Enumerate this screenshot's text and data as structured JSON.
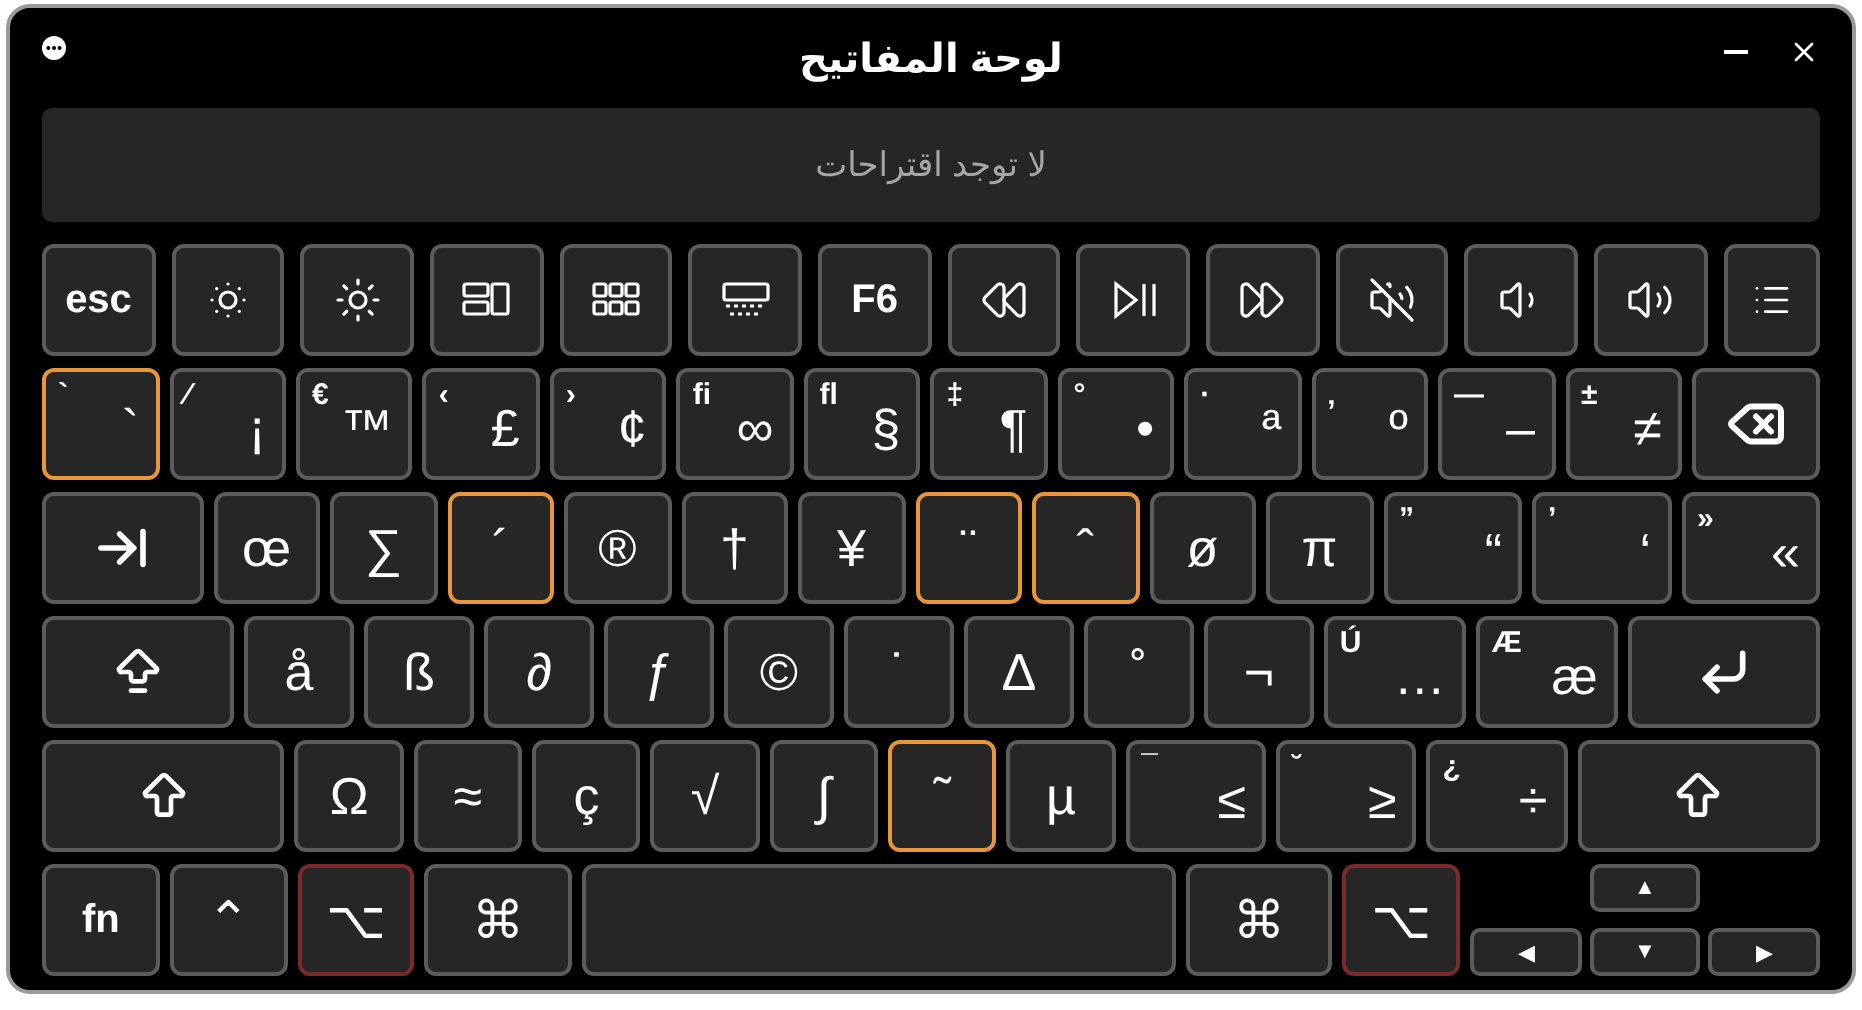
{
  "window": {
    "title": "لوحة المفاتيح"
  },
  "suggestions": {
    "text": "لا توجد اقتراحات"
  },
  "rows": [
    {
      "keys": [
        {
          "kind": "menu",
          "highlighted": false,
          "pressed": false
        },
        {
          "kind": "volup",
          "highlighted": false,
          "pressed": false
        },
        {
          "kind": "voldown",
          "highlighted": false,
          "pressed": false
        },
        {
          "kind": "mute",
          "highlighted": false,
          "pressed": false
        },
        {
          "kind": "forward",
          "highlighted": false,
          "pressed": false
        },
        {
          "kind": "play",
          "highlighted": false,
          "pressed": false
        },
        {
          "kind": "rewind",
          "highlighted": false,
          "pressed": false
        },
        {
          "kind": "text",
          "main": "F6",
          "highlighted": false,
          "pressed": false
        },
        {
          "kind": "backlight",
          "highlighted": false,
          "pressed": false
        },
        {
          "kind": "launchpad",
          "highlighted": false,
          "pressed": false
        },
        {
          "kind": "mission",
          "highlighted": false,
          "pressed": false
        },
        {
          "kind": "bright",
          "highlighted": false,
          "pressed": false
        },
        {
          "kind": "dim",
          "highlighted": false,
          "pressed": false
        },
        {
          "kind": "text",
          "main": "esc",
          "highlighted": false,
          "pressed": false
        }
      ]
    },
    {
      "keys": [
        {
          "kind": "delete",
          "highlighted": false,
          "pressed": false
        },
        {
          "kind": "char",
          "top": "±",
          "main": "≠",
          "highlighted": false,
          "pressed": false
        },
        {
          "kind": "char",
          "top": "—",
          "main": "–",
          "highlighted": false,
          "pressed": false
        },
        {
          "kind": "char",
          "top": "‚",
          "main": "º",
          "highlighted": false,
          "pressed": false
        },
        {
          "kind": "char",
          "top": "·",
          "main": "ª",
          "highlighted": false,
          "pressed": false
        },
        {
          "kind": "char",
          "top": "°",
          "main": "•",
          "highlighted": false,
          "pressed": false
        },
        {
          "kind": "char",
          "top": "‡",
          "main": "¶",
          "highlighted": false,
          "pressed": false
        },
        {
          "kind": "char",
          "top": "ﬂ",
          "main": "§",
          "highlighted": false,
          "pressed": false
        },
        {
          "kind": "char",
          "top": "ﬁ",
          "main": "∞",
          "highlighted": false,
          "pressed": false
        },
        {
          "kind": "char",
          "top": "›",
          "main": "¢",
          "highlighted": false,
          "pressed": false
        },
        {
          "kind": "char",
          "top": "‹",
          "main": "£",
          "highlighted": false,
          "pressed": false
        },
        {
          "kind": "char",
          "top": "€",
          "main": "™",
          "highlighted": false,
          "pressed": false
        },
        {
          "kind": "char",
          "top": "⁄",
          "main": "¡",
          "highlighted": false,
          "pressed": false
        },
        {
          "kind": "char",
          "top": "`",
          "main": "`",
          "highlighted": true,
          "pressed": false
        }
      ]
    },
    {
      "keys": [
        {
          "kind": "char",
          "top": "»",
          "main": "«",
          "highlighted": false,
          "pressed": false
        },
        {
          "kind": "char",
          "top": "’",
          "main": "‘",
          "highlighted": false,
          "pressed": false
        },
        {
          "kind": "char",
          "top": "”",
          "main": "“",
          "highlighted": false,
          "pressed": false
        },
        {
          "kind": "char",
          "main": "π",
          "highlighted": false,
          "pressed": false
        },
        {
          "kind": "char",
          "main": "ø",
          "highlighted": false,
          "pressed": false
        },
        {
          "kind": "char",
          "main": "ˆ",
          "highlighted": true,
          "pressed": false
        },
        {
          "kind": "char",
          "main": "¨",
          "highlighted": true,
          "pressed": false
        },
        {
          "kind": "char",
          "main": "¥",
          "highlighted": false,
          "pressed": false
        },
        {
          "kind": "char",
          "main": "†",
          "highlighted": false,
          "pressed": false
        },
        {
          "kind": "char",
          "main": "®",
          "highlighted": false,
          "pressed": false
        },
        {
          "kind": "char",
          "main": "´",
          "highlighted": true,
          "pressed": false
        },
        {
          "kind": "char",
          "main": "∑",
          "highlighted": false,
          "pressed": false
        },
        {
          "kind": "char",
          "main": "œ",
          "highlighted": false,
          "pressed": false
        },
        {
          "kind": "tab",
          "highlighted": false,
          "pressed": false
        }
      ]
    },
    {
      "keys": [
        {
          "kind": "return",
          "highlighted": false,
          "pressed": false
        },
        {
          "kind": "char",
          "top": "Æ",
          "main": "æ",
          "highlighted": false,
          "pressed": false
        },
        {
          "kind": "char",
          "top": "Ú",
          "main": "…",
          "highlighted": false,
          "pressed": false
        },
        {
          "kind": "char",
          "main": "¬",
          "highlighted": false,
          "pressed": false
        },
        {
          "kind": "char",
          "main": "˚",
          "highlighted": false,
          "pressed": false
        },
        {
          "kind": "char",
          "main": "∆",
          "highlighted": false,
          "pressed": false
        },
        {
          "kind": "char",
          "main": "˙",
          "highlighted": false,
          "pressed": false
        },
        {
          "kind": "char",
          "main": "©",
          "highlighted": false,
          "pressed": false
        },
        {
          "kind": "char",
          "main": "ƒ",
          "highlighted": false,
          "pressed": false
        },
        {
          "kind": "char",
          "main": "∂",
          "highlighted": false,
          "pressed": false
        },
        {
          "kind": "char",
          "main": "ß",
          "highlighted": false,
          "pressed": false
        },
        {
          "kind": "char",
          "main": "å",
          "highlighted": false,
          "pressed": false
        },
        {
          "kind": "caps",
          "highlighted": false,
          "pressed": false
        }
      ]
    },
    {
      "keys": [
        {
          "kind": "shift",
          "highlighted": false,
          "pressed": false
        },
        {
          "kind": "char",
          "top": "¿",
          "main": "÷",
          "highlighted": false,
          "pressed": false
        },
        {
          "kind": "char",
          "top": "˘",
          "main": "≥",
          "highlighted": false,
          "pressed": false
        },
        {
          "kind": "char",
          "top": "¯",
          "main": "≤",
          "highlighted": false,
          "pressed": false
        },
        {
          "kind": "char",
          "main": "µ",
          "highlighted": false,
          "pressed": false
        },
        {
          "kind": "char",
          "main": "˜",
          "highlighted": true,
          "pressed": false
        },
        {
          "kind": "char",
          "main": "∫",
          "highlighted": false,
          "pressed": false
        },
        {
          "kind": "char",
          "main": "√",
          "highlighted": false,
          "pressed": false
        },
        {
          "kind": "char",
          "main": "ç",
          "highlighted": false,
          "pressed": false
        },
        {
          "kind": "char",
          "main": "≈",
          "highlighted": false,
          "pressed": false
        },
        {
          "kind": "char",
          "main": "Ω",
          "highlighted": false,
          "pressed": false
        },
        {
          "kind": "shift",
          "highlighted": false,
          "pressed": false
        }
      ]
    },
    {
      "keys": [
        {
          "kind": "char",
          "main": "⌥",
          "highlighted": false,
          "pressed": true
        },
        {
          "kind": "command",
          "main": "⌘",
          "highlighted": false,
          "pressed": false
        },
        {
          "kind": "space",
          "highlighted": false,
          "pressed": false
        },
        {
          "kind": "command",
          "main": "⌘",
          "highlighted": false,
          "pressed": false
        },
        {
          "kind": "char",
          "main": "⌥",
          "highlighted": false,
          "pressed": true
        },
        {
          "kind": "char",
          "main": "⌃",
          "highlighted": false,
          "pressed": false
        },
        {
          "kind": "text",
          "main": "fn",
          "highlighted": false,
          "pressed": false
        }
      ]
    }
  ],
  "arrow_keys": [
    {
      "label": "▲"
    },
    {
      "label": "▶"
    },
    {
      "label": "▼"
    },
    {
      "label": "◀"
    }
  ]
}
